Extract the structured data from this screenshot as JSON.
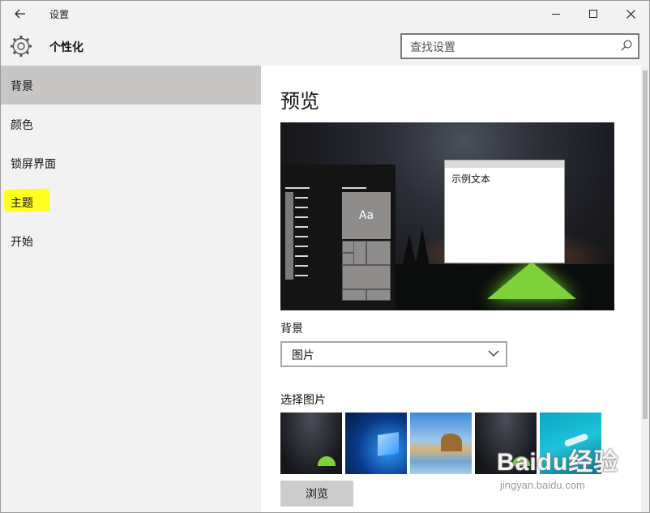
{
  "window": {
    "title": "设置",
    "back_icon": "arrow-left-icon",
    "controls": [
      "minimize-icon",
      "maximize-icon",
      "close-icon"
    ]
  },
  "header": {
    "section_title": "个性化",
    "section_icon": "gear-icon",
    "search_placeholder": "查找设置",
    "search_icon": "search-icon"
  },
  "sidebar": {
    "items": [
      {
        "label": "背景",
        "active": true
      },
      {
        "label": "颜色",
        "active": false
      },
      {
        "label": "锁屏界面",
        "active": false
      },
      {
        "label": "主题",
        "active": false,
        "highlighted": true
      },
      {
        "label": "开始",
        "active": false
      }
    ],
    "highlight_color": "#ffff22"
  },
  "main": {
    "preview_title": "预览",
    "preview": {
      "tile_text": "Aa",
      "sample_text": "示例文本"
    },
    "background_label": "背景",
    "background_select": {
      "value": "图片",
      "icon": "chevron-down-icon"
    },
    "choose_picture_label": "选择图片",
    "pictures": [
      "night-sky-tent",
      "windows-blue",
      "beach-rock-arch",
      "night-sky-tent",
      "underwater-swimmer"
    ],
    "browse_label": "浏览"
  },
  "watermark": {
    "brand": "Baidu经验",
    "url": "jingyan.baidu.com"
  },
  "colors": {
    "active_nav_bg": "#c8c6c4",
    "tent_green": "#7fd13a",
    "button_bg": "#cccccc"
  }
}
